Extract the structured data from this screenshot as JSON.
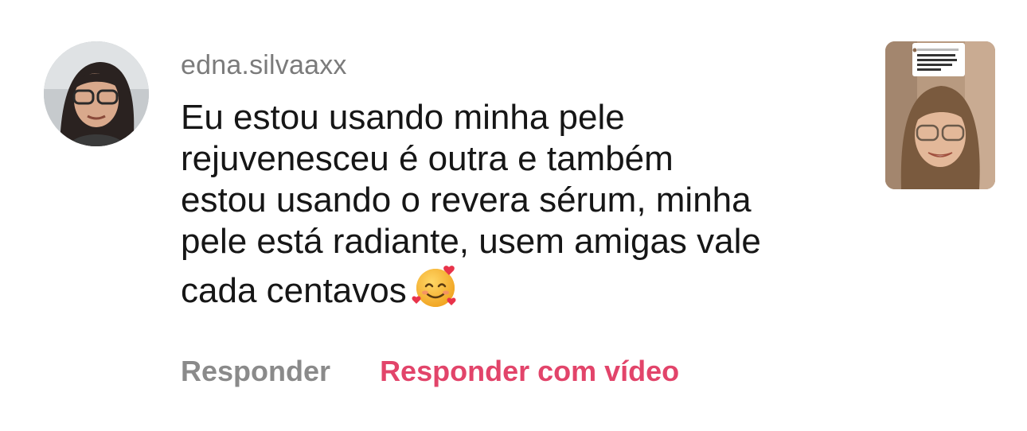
{
  "comment": {
    "username": "edna.silvaaxx",
    "text_lines": [
      "Eu estou usando minha pele",
      "rejuvenesceu é outra e também",
      "estou usando o revera sérum, minha",
      "pele está radiante, usem amigas vale",
      "cada centavos"
    ],
    "emoji_icon": "smiling-face-with-hearts-icon",
    "actions": {
      "reply_label": "Responder",
      "reply_video_label": "Responder com vídeo"
    }
  },
  "colors": {
    "username": "#7b7b7b",
    "text": "#161616",
    "reply": "#8a8a8a",
    "reply_video": "#e2446a"
  },
  "video_thumbnail": {
    "icon": "video-thumbnail-image"
  }
}
